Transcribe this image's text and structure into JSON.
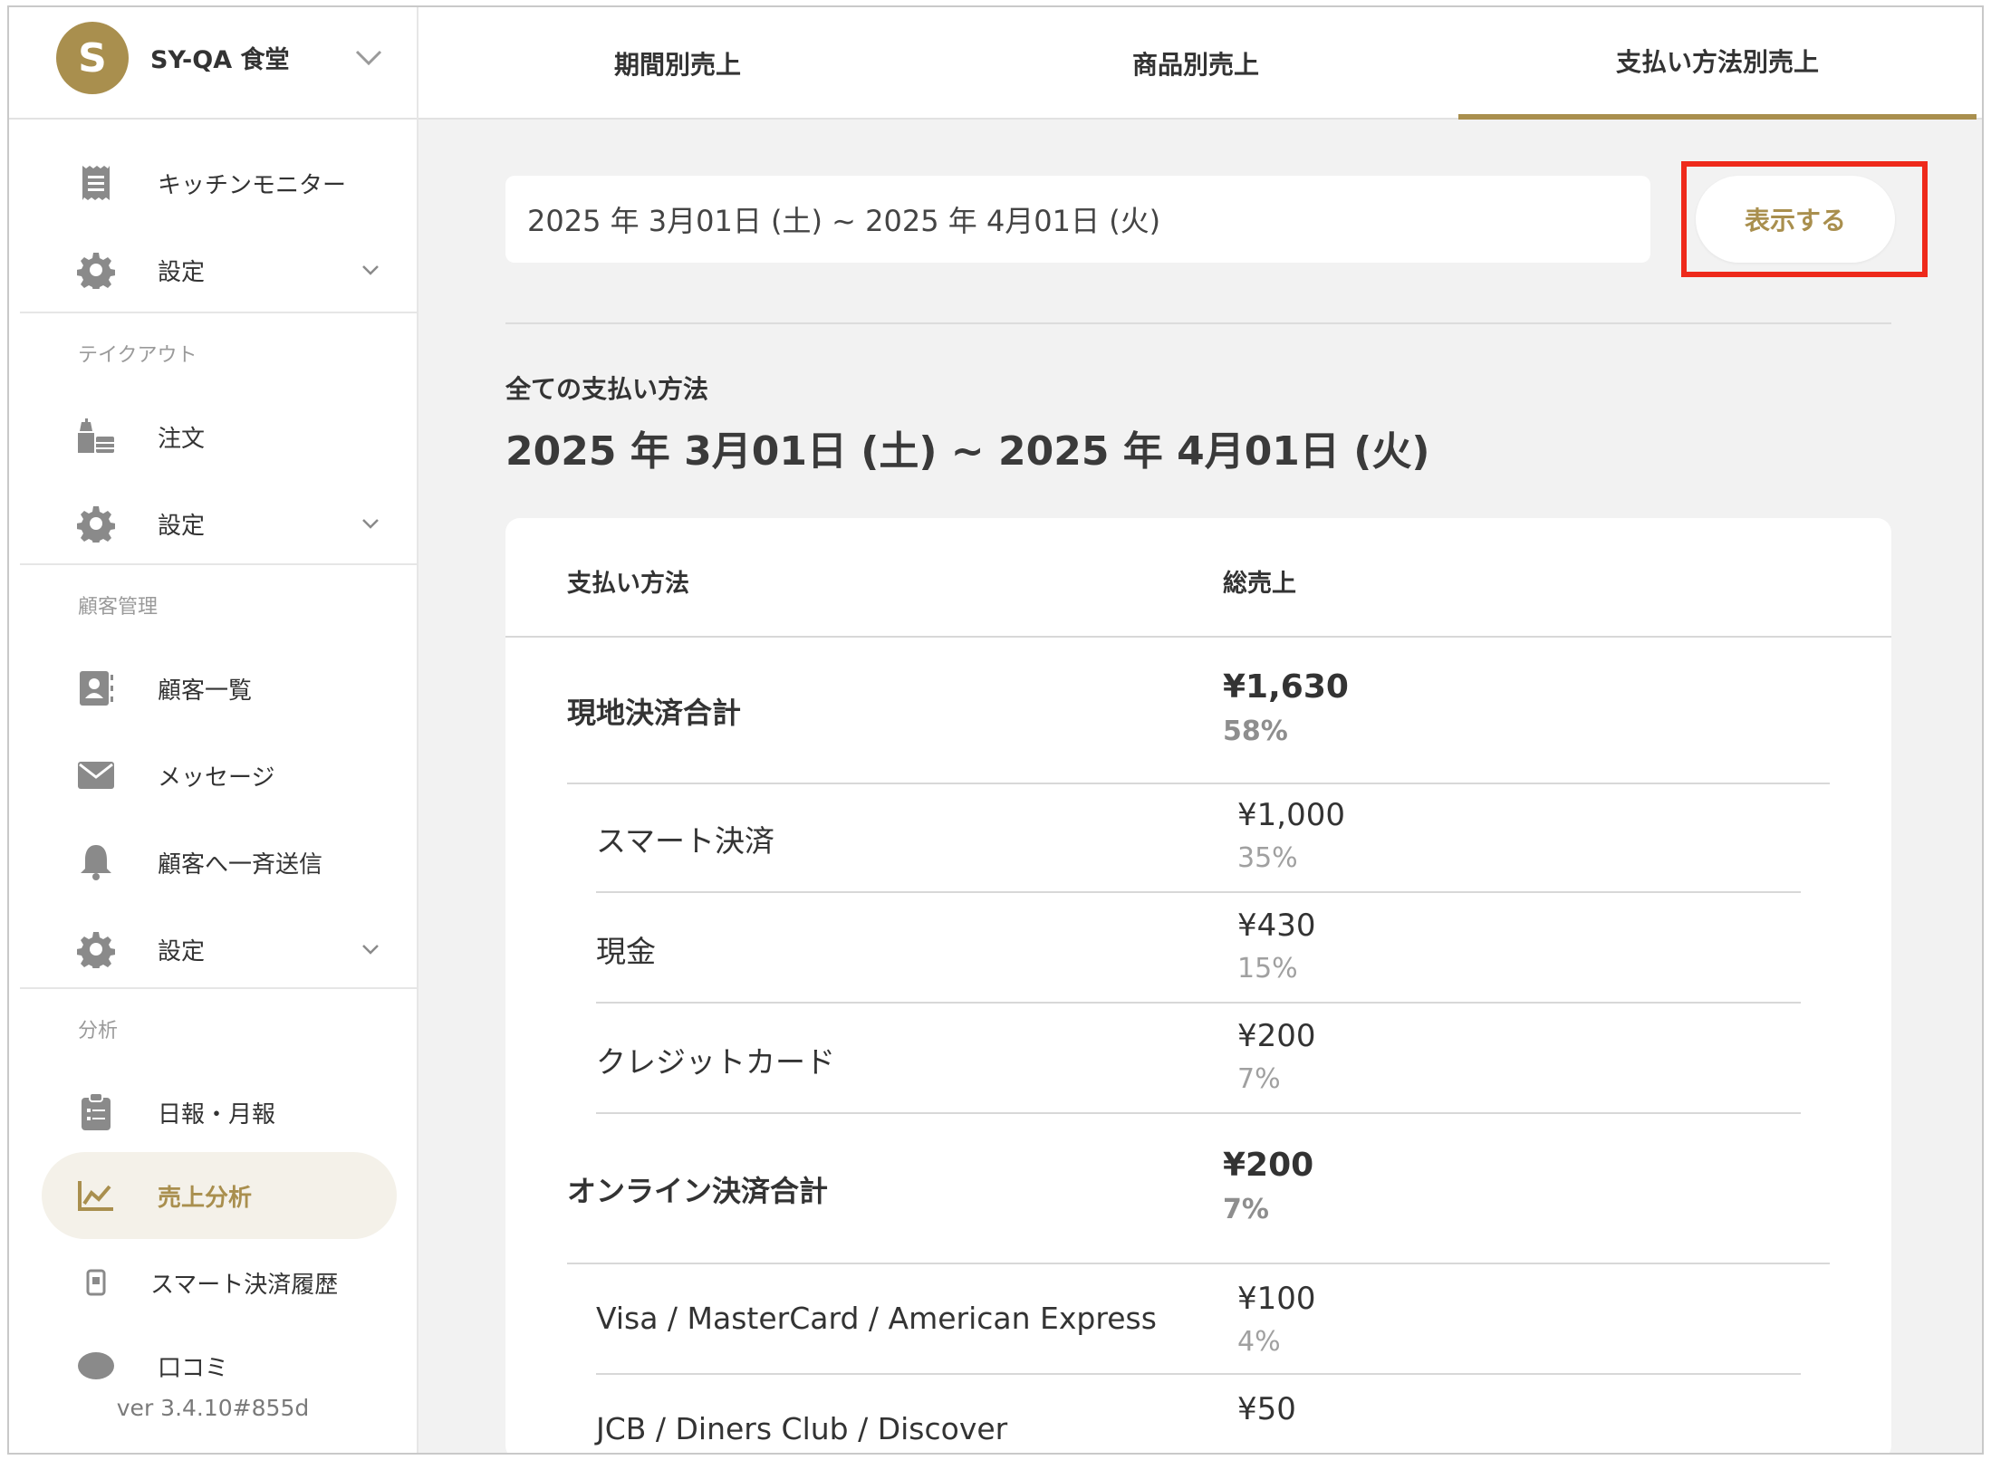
{
  "store": {
    "initial": "S",
    "name": "SY-QA 食堂"
  },
  "sidebar": {
    "top_items": [
      {
        "label": "キッチンモニター",
        "icon": "receipt-icon"
      },
      {
        "label": "設定",
        "icon": "gear-icon"
      }
    ],
    "sections": [
      {
        "title": "テイクアウト",
        "items": [
          {
            "label": "注文",
            "icon": "takeout-icon"
          },
          {
            "label": "設定",
            "icon": "gear-icon"
          }
        ]
      },
      {
        "title": "顧客管理",
        "items": [
          {
            "label": "顧客一覧",
            "icon": "contacts-icon"
          },
          {
            "label": "メッセージ",
            "icon": "mail-icon"
          },
          {
            "label": "顧客へ一斉送信",
            "icon": "bell-icon"
          },
          {
            "label": "設定",
            "icon": "gear-icon"
          }
        ]
      },
      {
        "title": "分析",
        "items": [
          {
            "label": "日報・月報",
            "icon": "clipboard-icon"
          },
          {
            "label": "売上分析",
            "icon": "line-chart-icon",
            "active": true
          },
          {
            "label": "スマート決済履歴",
            "icon": "phone-icon"
          },
          {
            "label": "口コミ",
            "icon": "chat-icon"
          }
        ]
      }
    ],
    "version": "ver 3.4.10#855d"
  },
  "tabs": [
    {
      "label": "期間別売上"
    },
    {
      "label": "商品別売上"
    },
    {
      "label": "支払い方法別売上",
      "active": true
    }
  ],
  "filter": {
    "date_range": "2025 年 3月01日 (土) ~ 2025 年 4月01日 (火)",
    "show_button": "表示する"
  },
  "summary": {
    "label": "全ての支払い方法",
    "range": "2025 年 3月01日 (土) ~ 2025 年 4月01日 (火)"
  },
  "table": {
    "headers": {
      "method": "支払い方法",
      "total": "総売上"
    },
    "groups": [
      {
        "name": "現地決済合計",
        "amount": "¥1,630",
        "percent": "58%",
        "items": [
          {
            "name": "スマート決済",
            "amount": "¥1,000",
            "percent": "35%"
          },
          {
            "name": "現金",
            "amount": "¥430",
            "percent": "15%"
          },
          {
            "name": "クレジットカード",
            "amount": "¥200",
            "percent": "7%"
          }
        ]
      },
      {
        "name": "オンライン決済合計",
        "amount": "¥200",
        "percent": "7%",
        "items": [
          {
            "name": "Visa / MasterCard / American Express",
            "amount": "¥100",
            "percent": "4%"
          },
          {
            "name": "JCB / Diners Club / Discover",
            "amount": "¥50",
            "percent": ""
          }
        ]
      }
    ]
  },
  "colors": {
    "accent": "#a98f4e",
    "highlight": "#ee2a1b",
    "main_bg": "#f2f2f2"
  }
}
